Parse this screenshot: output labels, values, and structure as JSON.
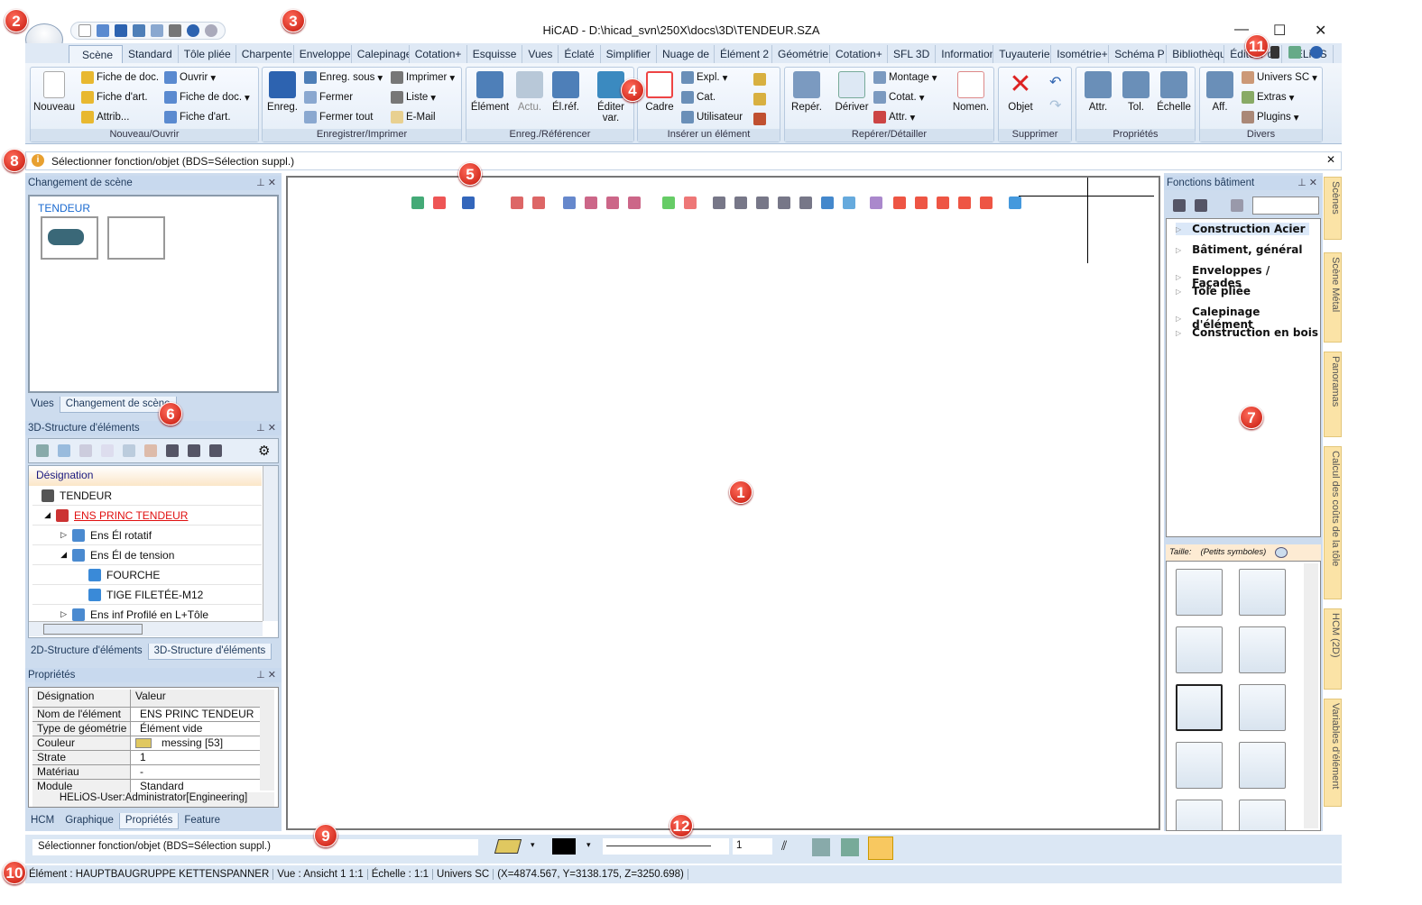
{
  "window": {
    "title": "HiCAD - D:\\hicad_svn\\250X\\docs\\3D\\TENDEUR.SZA",
    "minimize": "—",
    "maximize": "☐",
    "close": "✕"
  },
  "ribbon_tabs": [
    "Scène",
    "Standard",
    "Tôle pliée",
    "Charpente",
    "Enveloppe",
    "Calepinage",
    "Cotation+",
    "Esquisse",
    "Vues",
    "Éclaté",
    "Simplifier",
    "Nuage de",
    "Élément 2",
    "Géométrie",
    "Cotation+",
    "SFL 3D",
    "Information",
    "Tuyauterie",
    "Isométrie+",
    "Schéma P",
    "Bibliothèque",
    "Éditeur de",
    "HELiOS"
  ],
  "ribbon_groups": {
    "nouveau_ouvrir": {
      "label": "Nouveau/Ouvrir",
      "nouveau": "Nouveau",
      "fiche_doc": "Fiche de doc.",
      "fiche_art": "Fiche d'art.",
      "attrib": "Attrib...",
      "ouvrir": "Ouvrir",
      "fiche_doc2": "Fiche de doc.",
      "fiche_art2": "Fiche d'art."
    },
    "enregistrer": {
      "label": "Enregistrer/Imprimer",
      "enreg": "Enreg.",
      "enreg_sous": "Enreg. sous",
      "fermer": "Fermer",
      "fermer_tout": "Fermer tout",
      "imprimer": "Imprimer",
      "liste": "Liste",
      "email": "E-Mail"
    },
    "referencer": {
      "label": "Enreg./Référencer",
      "element": "Élément",
      "actu": "Actu.",
      "elref": "Él.réf.",
      "editer": "Éditer var."
    },
    "inserer": {
      "label": "Insérer un élément",
      "cadre": "Cadre",
      "expl": "Expl.",
      "cat": "Cat.",
      "utilisateur": "Utilisateur"
    },
    "reperer": {
      "label": "Repérer/Détailler",
      "reper": "Repér.",
      "deriver": "Dériver",
      "montage": "Montage",
      "cotat": "Cotat.",
      "attr": "Attr.",
      "nomen": "Nomen."
    },
    "supprimer": {
      "label": "Supprimer",
      "objet": "Objet"
    },
    "proprietes": {
      "label": "Propriétés",
      "attr": "Attr.",
      "tol": "Tol.",
      "echelle": "Échelle"
    },
    "divers": {
      "label": "Divers",
      "aff": "Aff.",
      "univers": "Univers SC",
      "extras": "Extras",
      "plugins": "Plugins"
    }
  },
  "infobar": {
    "text": "Sélectionner fonction/objet (BDS=Sélection suppl.)"
  },
  "scene_panel": {
    "title": "Changement de scène",
    "scene_name": "TENDEUR",
    "tabs": [
      "Vues",
      "Changement de scène"
    ]
  },
  "structure_panel": {
    "title": "3D-Structure d'éléments",
    "column": "Désignation",
    "rows": [
      {
        "label": "TENDEUR"
      },
      {
        "label": "ENS PRINC TENDEUR",
        "active": true
      },
      {
        "label": "Ens Él rotatif"
      },
      {
        "label": "Ens Él de tension"
      },
      {
        "label": "FOURCHE"
      },
      {
        "label": "TIGE FILETÉE-M12"
      },
      {
        "label": "Ens inf Profilé en L+Tôle"
      }
    ],
    "tabs": [
      "2D-Structure d'éléments",
      "3D-Structure d'éléments"
    ]
  },
  "properties_panel": {
    "title": "Propriétés",
    "col_key": "Désignation",
    "col_value": "Valeur",
    "rows": [
      {
        "k": "Nom de l'élément",
        "v": "ENS PRINC TENDEUR"
      },
      {
        "k": "Type de géométrie",
        "v": "Élément vide"
      },
      {
        "k": "Couleur",
        "v": "messing [53]",
        "swatch": "#e0c860"
      },
      {
        "k": "Strate",
        "v": "1"
      },
      {
        "k": "Matériau",
        "v": "-"
      },
      {
        "k": "Module",
        "v": "Standard"
      }
    ],
    "footer": "HELiOS-User:Administrator[Engineering]",
    "tabs": [
      "HCM",
      "Graphique",
      "Propriétés",
      "Feature"
    ]
  },
  "building_panel": {
    "title": "Fonctions bâtiment",
    "categories": [
      "Construction Acier",
      "Bâtiment, général",
      "Enveloppes / Façades",
      "Tôle pliée",
      "Calepinage d'élément",
      "Construction en bois"
    ],
    "size_label": "Taille:",
    "size_value": "(Petits symboles)"
  },
  "side_tabs": [
    "Scènes",
    "Scène Métal",
    "Panoramas",
    "Calcul des coûts de la tôle",
    "HCM (2D)",
    "Variables d'élément"
  ],
  "command_bar": {
    "prompt": "Sélectionner fonction/objet (BDS=Sélection suppl.)",
    "line_width": "1",
    "fill_color": "#e0c860",
    "line_color": "#000000"
  },
  "status_bar": {
    "element": "Élément : HAUPTBAUGRUPPE KETTENSPANNER",
    "vue": "Vue : Ansicht 1 1:1",
    "echelle": "Échelle : 1:1",
    "univers": "Univers SC",
    "coords": "(X=4874.567, Y=3138.175, Z=3250.698)"
  },
  "badges": [
    "1",
    "2",
    "3",
    "4",
    "5",
    "6",
    "7",
    "8",
    "9",
    "10",
    "11",
    "12"
  ]
}
